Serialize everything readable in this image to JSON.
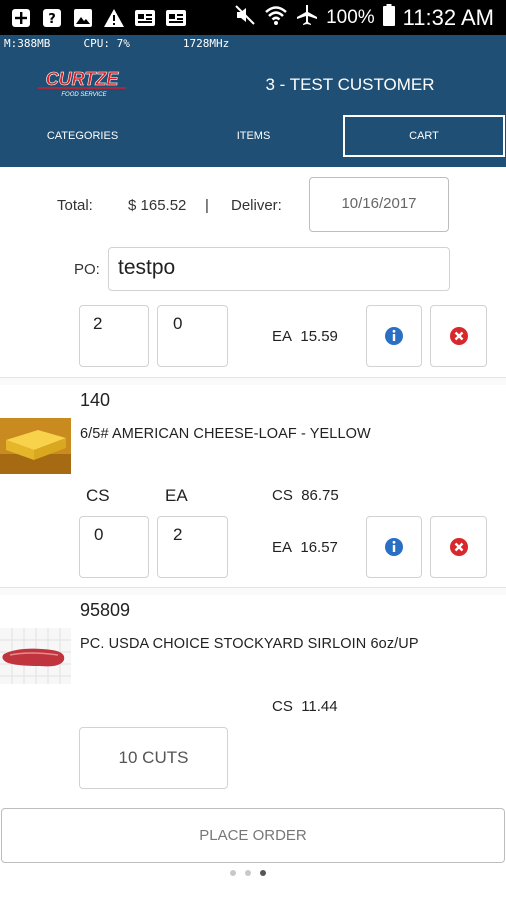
{
  "status_bar": {
    "battery": "100%",
    "time": "11:32 AM",
    "icons": [
      "plus-box-icon",
      "help-box-icon",
      "image-icon",
      "warning-icon",
      "id-card-icon",
      "id-card-icon",
      "mute-icon",
      "wifi-icon",
      "airplane-icon",
      "battery-icon"
    ]
  },
  "debug_bar": {
    "memory": "M:388MB",
    "cpu": "CPU: 7%",
    "freq": "1728MHz"
  },
  "header": {
    "logo_text": "CURTZE",
    "logo_subtext": "FOOD SERVICE",
    "customer": "3 - TEST CUSTOMER",
    "tabs": [
      {
        "label": "CATEGORIES",
        "active": false
      },
      {
        "label": "ITEMS",
        "active": false
      },
      {
        "label": "CART",
        "active": true
      }
    ]
  },
  "summary": {
    "total_label": "Total:",
    "total_value": "$ 165.52",
    "separator": "|",
    "deliver_label": "Deliver:",
    "deliver_date": "10/16/2017",
    "po_label": "PO:",
    "po_value": "testpo"
  },
  "items": [
    {
      "qty_cs": "2",
      "qty_ea": "0",
      "ea_label": "EA",
      "ea_price": "15.59"
    },
    {
      "sku": "140",
      "description": "6/5# AMERICAN CHEESE-LOAF - YELLOW",
      "cs_header": "CS",
      "ea_header": "EA",
      "cs_label": "CS",
      "cs_price": "86.75",
      "qty_cs": "0",
      "qty_ea": "2",
      "ea_label": "EA",
      "ea_price": "16.57"
    },
    {
      "sku": "95809",
      "description": "PC. USDA CHOICE STOCKYARD SIRLOIN 6oz/UP",
      "cs_label": "CS",
      "cs_price": "11.44",
      "cuts_label": "10 CUTS"
    }
  ],
  "footer": {
    "place_order": "PLACE ORDER",
    "page_dots": 3,
    "active_dot": 3
  },
  "colors": {
    "header_bg": "#1f4f74",
    "info_blue": "#2a6fc4",
    "remove_red": "#d8282b",
    "logo_red": "#d61f26"
  }
}
